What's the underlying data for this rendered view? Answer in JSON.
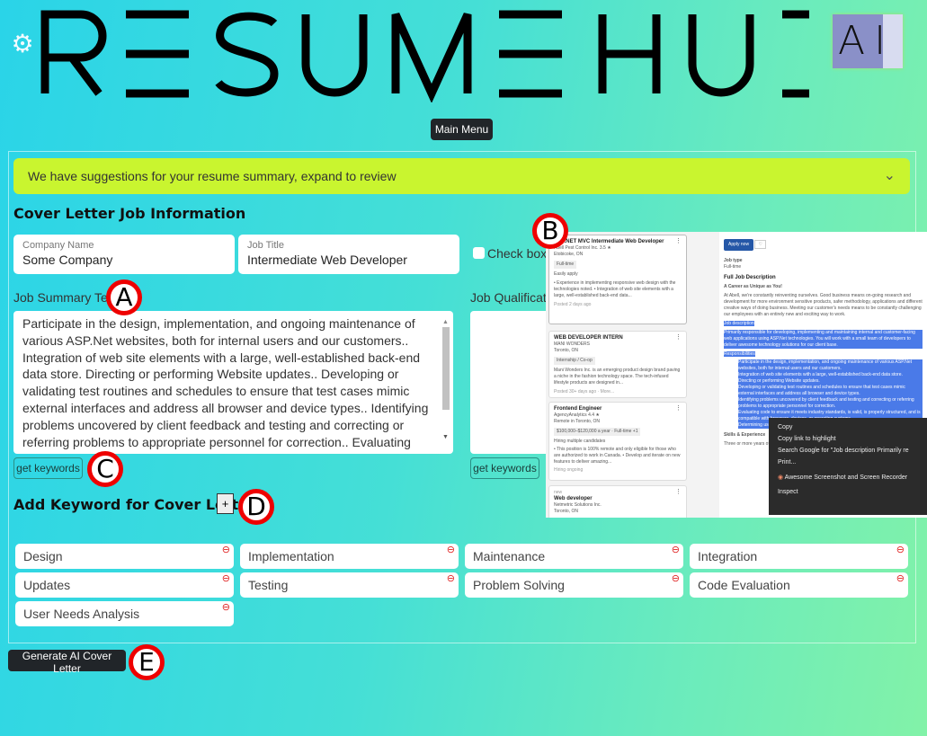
{
  "header": {
    "logo_text": "RESUME HUB",
    "logo_badge": "AI",
    "settings_icon": "gear-icon",
    "main_menu_label": "Main Menu"
  },
  "banner": {
    "text": "We have suggestions for your resume summary, expand to review",
    "icon": "chevron-down-icon"
  },
  "job_info": {
    "heading": "Cover Letter Job Information",
    "company": {
      "label": "Company Name",
      "value": "Some Company"
    },
    "job_title": {
      "label": "Job Title",
      "value": "Intermediate Web Developer"
    },
    "checkbox_label": "Check box i",
    "summary_label": "Job Summary Text",
    "summary_text": "Participate in the design, implementation, and ongoing maintenance of various ASP.Net websites, both for internal users and our customers.. Integration of web site elements with a large, well-established back-end data store. Directing or performing Website updates.. Developing or validating test routines and schedules to ensure that test cases mimic external interfaces and address all browser and device types.. Identifying problems uncovered by client feedback and testing and correcting or referring problems to appropriate personnel for correction.. Evaluating code to ensure it meets industry standards, is valid, is properly",
    "qualifications_label": "Job Qualificatio",
    "qualifications_text": "",
    "get_keywords_label": "get keywords"
  },
  "keywords": {
    "heading": "Add Keyword for Cover Letter",
    "add_label": "+",
    "items": [
      "Design",
      "Implementation",
      "Maintenance",
      "Integration",
      "Updates",
      "Testing",
      "Problem Solving",
      "Code Evaluation",
      "User Needs Analysis"
    ],
    "remove_icon": "minus-circle-icon"
  },
  "generate_label": "Generate AI Cover Letter",
  "markers": [
    "A",
    "B",
    "C",
    "D",
    "E"
  ],
  "embedded_screenshot": {
    "cards": [
      {
        "title": "ASP.NET MVC Intermediate Web Developer",
        "company": "Abell Pest Control Inc. 3.5 ★",
        "location": "Etobicoke, ON",
        "tag": "Full-time",
        "extra": "Easily apply",
        "bullets": "• Experience in implementing responsive web design with the technologies noted. • Integration of web site elements with a large, well-established back-end data...",
        "posted": "Posted 2 days ago"
      },
      {
        "title": "WEB DEVELOPER INTERN",
        "company": "MANI WONDERS",
        "location": "Toronto, ON",
        "tag": "Internship / Co-op",
        "extra": "",
        "bullets": "Mani Wonders Inc. is an emerging product design brand paving a niche in the fashion technology space. The tech-infused lifestyle products are designed in...",
        "posted": "Posted 30+ days ago · More..."
      },
      {
        "title": "Frontend Engineer",
        "company": "AgencyAnalytics 4.4 ★",
        "location": "Remote in Toronto, ON",
        "tag": "$100,000–$120,000 a year · Full-time +1",
        "extra": "Hiring multiple candidates",
        "bullets": "• This position is 100% remote and only eligible for those who are authorized to work in Canada. • Develop and iterate on new features to deliver amazing...",
        "posted": "Hiring ongoing"
      },
      {
        "title": "Web developer",
        "company": "Netmetric Solutions Inc.",
        "location": "Toronto, ON",
        "tag": "",
        "extra": "new",
        "bullets": "",
        "posted": ""
      }
    ],
    "apply_label": "Apply now",
    "job_type_label": "Job type",
    "job_type": "Full-time",
    "full_desc_heading": "Full Job Description",
    "subheading": "A Career as Unique as You!",
    "intro": "At Abell, we're constantly reinventing ourselves. Good business means on-going research and development for more environment sensitive products, safer methodology, applications and different creative ways of doing business. Meeting our customer's needs means to be constantly challenging our employees with an entirely new and exciting way to work.",
    "jd_heading": "Job description",
    "jd_text": "Primarily responsible for developing, implementing and maintaining internal and customer-facing web applications using ASP.Net technologies. You will work with a small team of developers to deliver awesome technology solutions for our client base.",
    "resp_heading": "Responsibilities",
    "resp_items": [
      "Participate in the design, implementation, and ongoing maintenance of various ASP.Net websites, both for internal users and our customers.",
      "Integration of web site elements with a large, well-established back-end data store.",
      "Directing or performing Website updates.",
      "Developing or validating test routines and schedules to ensure that test cases mimic external interfaces and address all browser and device types.",
      "Identifying problems uncovered by client feedback and testing and correcting or referring problems to appropriate personnel for correction.",
      "Evaluating code to ensure it meets industry standards, is valid, is properly structured, and is compatible with browsers, devices, or operating systems.",
      "Determining user needs"
    ],
    "skills_heading": "Skills & Experience",
    "skills_text": "Three or more years of ... Domain experience in fi...",
    "context_menu": [
      "Copy",
      "Copy link to highlight",
      "Search Google for \"Job description  Primarily re",
      "Print...",
      "Awesome Screenshot and Screen Recorder",
      "Inspect"
    ]
  },
  "colors": {
    "banner": "#c9f52f",
    "dark_button": "#212529",
    "marker_red": "#e00000",
    "remove_red": "#e02020"
  }
}
